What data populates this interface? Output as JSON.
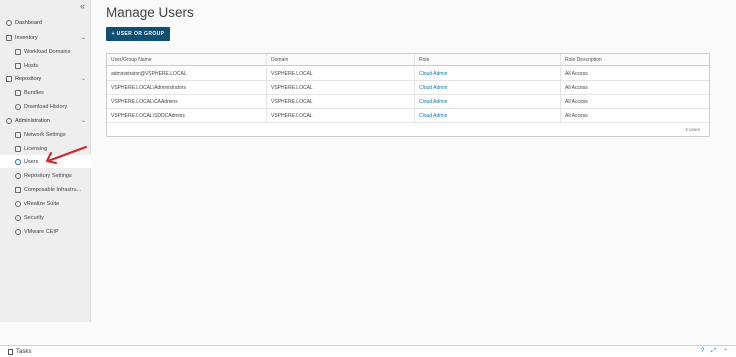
{
  "sidebar": {
    "collapse_label": "«",
    "items": [
      {
        "label": "Dashboard"
      },
      {
        "label": "Inventory",
        "chevron": "⌄"
      },
      {
        "label": "Workload Domains"
      },
      {
        "label": "Hosts"
      },
      {
        "label": "Repository",
        "chevron": "⌄"
      },
      {
        "label": "Bundles"
      },
      {
        "label": "Download History"
      },
      {
        "label": "Administration",
        "chevron": "⌄"
      },
      {
        "label": "Network Settings"
      },
      {
        "label": "Licensing"
      },
      {
        "label": "Users"
      },
      {
        "label": "Repository Settings"
      },
      {
        "label": "Composable Infrastru..."
      },
      {
        "label": "vRealize Suite"
      },
      {
        "label": "Security"
      },
      {
        "label": "VMware CEIP"
      }
    ]
  },
  "main": {
    "title": "Manage Users",
    "add_button": "+ USER OR GROUP",
    "columns": [
      "User/Group Name",
      "Domain",
      "Role",
      "Role Description"
    ],
    "rows": [
      {
        "name": "administrator@VSPHERE.LOCAL",
        "domain": "VSPHERE.LOCAL",
        "role": "Cloud Admin",
        "desc": "All Access"
      },
      {
        "name": "VSPHERE.LOCAL\\Administrators",
        "domain": "VSPHERE.LOCAL",
        "role": "Cloud Admin",
        "desc": "All Access"
      },
      {
        "name": "VSPHERE.LOCAL\\CAAdmins",
        "domain": "VSPHERE.LOCAL",
        "role": "Cloud Admin",
        "desc": "All Access"
      },
      {
        "name": "VSPHERE.LOCAL\\SDDCAdmins",
        "domain": "VSPHERE.LOCAL",
        "role": "Cloud Admin",
        "desc": "All Access"
      }
    ],
    "footer": "4 users"
  },
  "tasks": {
    "label": "Tasks",
    "help": "?",
    "expand": "⤢",
    "up": "⌃"
  },
  "colors": {
    "accent": "#0079b8",
    "button": "#0d4f75",
    "annotation_arrow": "#e02020"
  }
}
